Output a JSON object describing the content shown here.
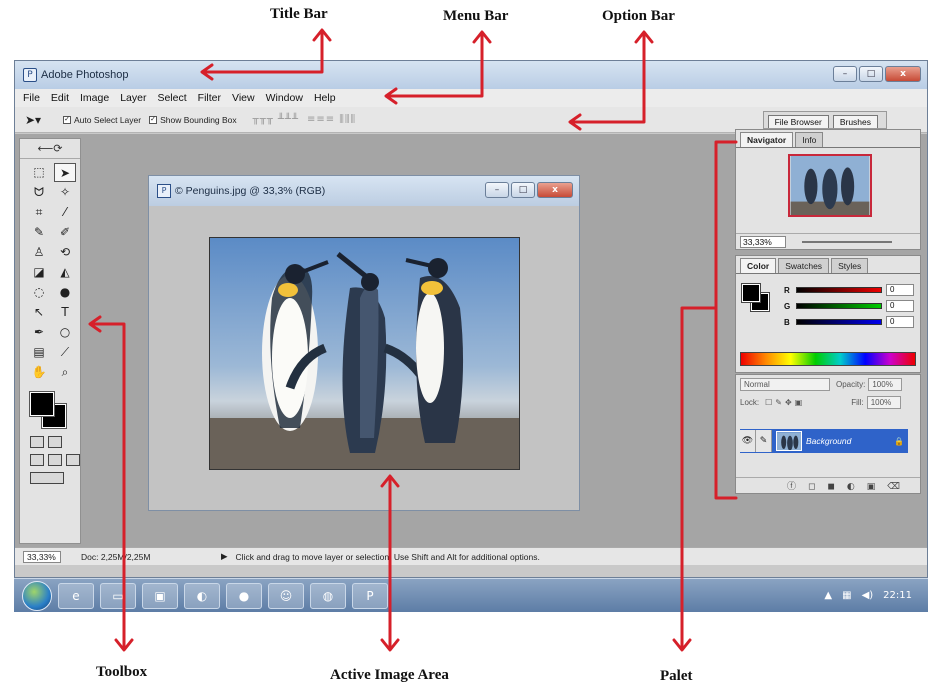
{
  "annotations": {
    "title_bar": "Title Bar",
    "menu_bar": "Menu Bar",
    "option_bar": "Option Bar",
    "toolbox": "Toolbox",
    "active_image_area": "Active Image Area",
    "palet": "Palet"
  },
  "colors": {
    "arrow": "#d6202a",
    "selected_layer": "#2f63c9",
    "taskbar": "#5d7da6"
  },
  "app": {
    "title": "Adobe Photoshop",
    "icon": "ps-app-icon",
    "window_buttons": [
      "minimize-icon",
      "maximize-icon",
      "close-icon"
    ]
  },
  "menu": [
    "File",
    "Edit",
    "Image",
    "Layer",
    "Select",
    "Filter",
    "View",
    "Window",
    "Help"
  ],
  "options": {
    "auto_select": "Auto Select Layer",
    "show_bounding": "Show Bounding Box",
    "well_tabs": [
      "File Browser",
      "Brushes"
    ]
  },
  "document": {
    "title": "© Penguins.jpg @ 33,3% (RGB)"
  },
  "navigator": {
    "tabs": [
      "Navigator",
      "Info"
    ],
    "zoom": "33,33%"
  },
  "color": {
    "tabs": [
      "Color",
      "Swatches",
      "Styles"
    ],
    "channels": [
      {
        "name": "R",
        "value": "0"
      },
      {
        "name": "G",
        "value": "0"
      },
      {
        "name": "B",
        "value": "0"
      }
    ]
  },
  "layers": {
    "blend": "Normal",
    "opacity_label": "Opacity:",
    "opacity": "100%",
    "lock_label": "Lock:",
    "fill_label": "Fill:",
    "fill": "100%",
    "layer_name": "Background"
  },
  "status": {
    "zoom": "33,33%",
    "doc": "Doc: 2,25M/2,25M",
    "message": "Click and drag to move layer or selection.  Use Shift and Alt for additional options."
  },
  "taskbar": {
    "clock": "22:11"
  }
}
